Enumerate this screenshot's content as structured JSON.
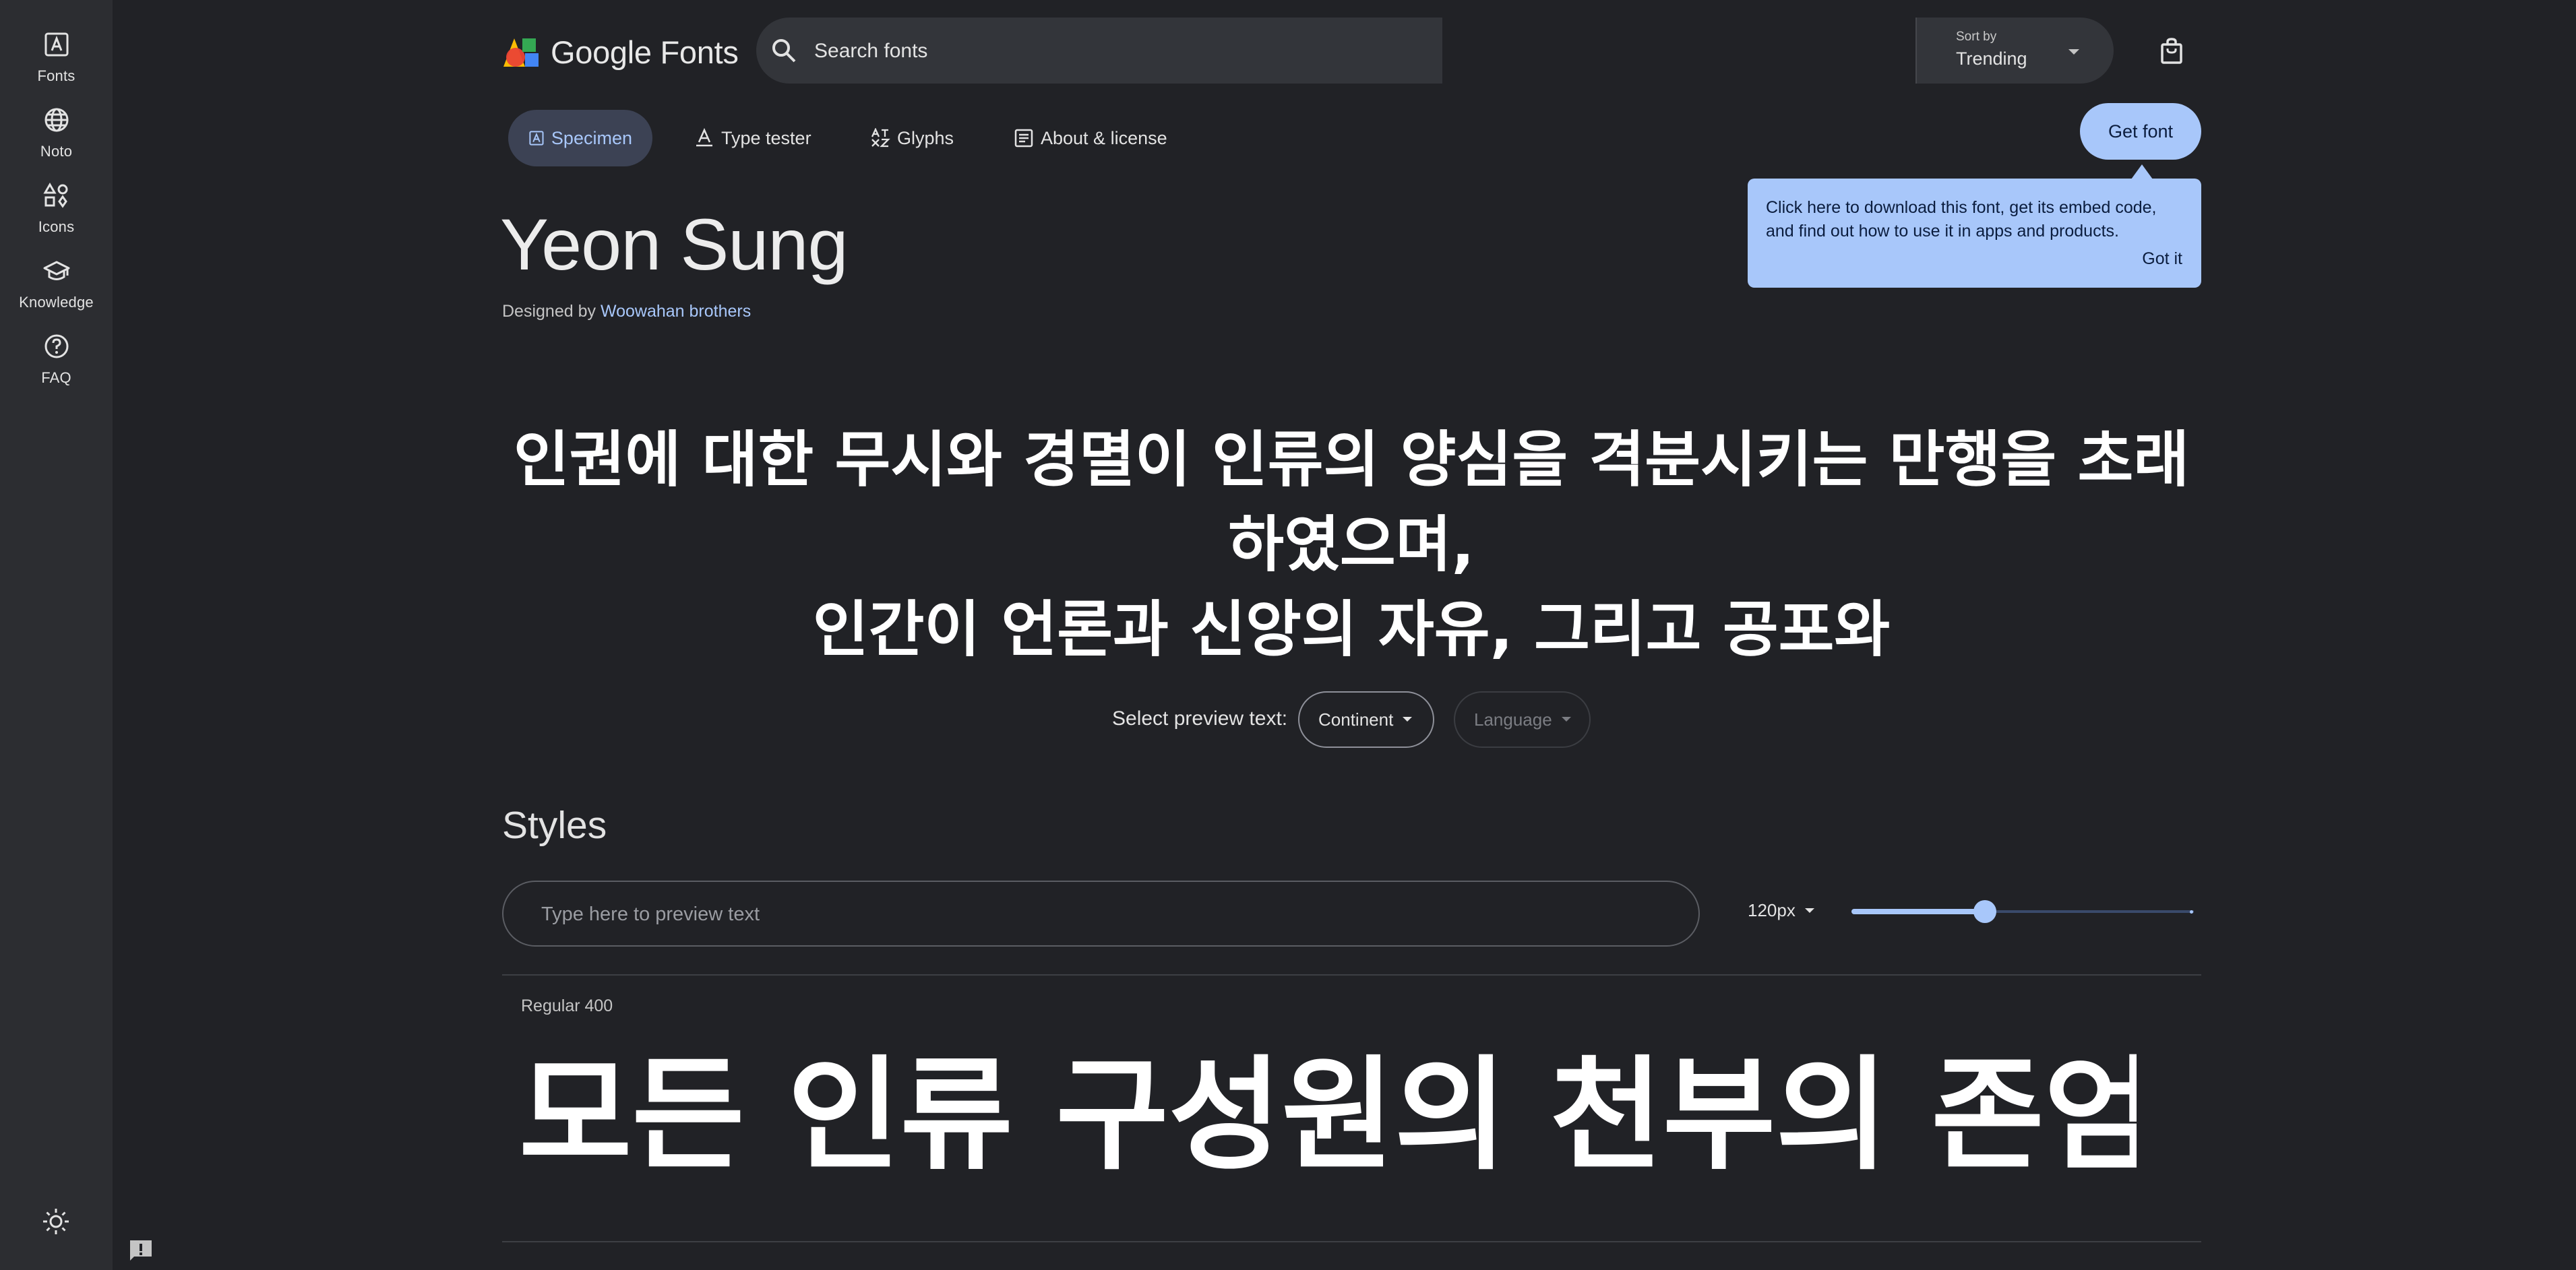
{
  "rail": {
    "items": [
      {
        "label": "Fonts",
        "icon": "font-icon"
      },
      {
        "label": "Noto",
        "icon": "globe-icon"
      },
      {
        "label": "Icons",
        "icon": "shapes-icon"
      },
      {
        "label": "Knowledge",
        "icon": "graduation-cap-icon"
      },
      {
        "label": "FAQ",
        "icon": "help-circle-icon"
      }
    ],
    "theme_icon": "brightness-icon",
    "feedback_icon": "feedback-icon"
  },
  "header": {
    "logo_text": "Google Fonts",
    "search_placeholder": "Search fonts",
    "sort_label": "Sort by",
    "sort_value": "Trending",
    "bag_icon": "shopping-bag-icon"
  },
  "tabs": [
    {
      "label": "Specimen",
      "active": true
    },
    {
      "label": "Type tester",
      "active": false
    },
    {
      "label": "Glyphs",
      "active": false
    },
    {
      "label": "About & license",
      "active": false
    }
  ],
  "get_font": {
    "label": "Get font",
    "tooltip_text": "Click here to download this font, get its embed code, and find out how to use it in apps and products.",
    "tooltip_action": "Got it"
  },
  "font": {
    "name": "Yeon Sung",
    "designed_by_prefix": "Designed by",
    "designer": "Woowahan brothers"
  },
  "hero": {
    "line1": "인권에 대한 무시와 경멸이 인류의 양심을 격분시키는 만행을 초래하였으며,",
    "line2": "인간이 언론과 신앙의 자유, 그리고 공포와"
  },
  "preview_select": {
    "label": "Select preview text:",
    "continent": "Continent",
    "language": "Language"
  },
  "styles": {
    "heading": "Styles",
    "preview_placeholder": "Type here to preview text",
    "size_value": "120px",
    "size_slider_fraction": 0.39,
    "items": [
      {
        "name": "Regular 400",
        "sample": "모든 인류 구성원의 천부의 존엄성과"
      }
    ]
  },
  "colors": {
    "background": "#212226",
    "rail": "#2c2d31",
    "accent": "#a8c7fa"
  }
}
